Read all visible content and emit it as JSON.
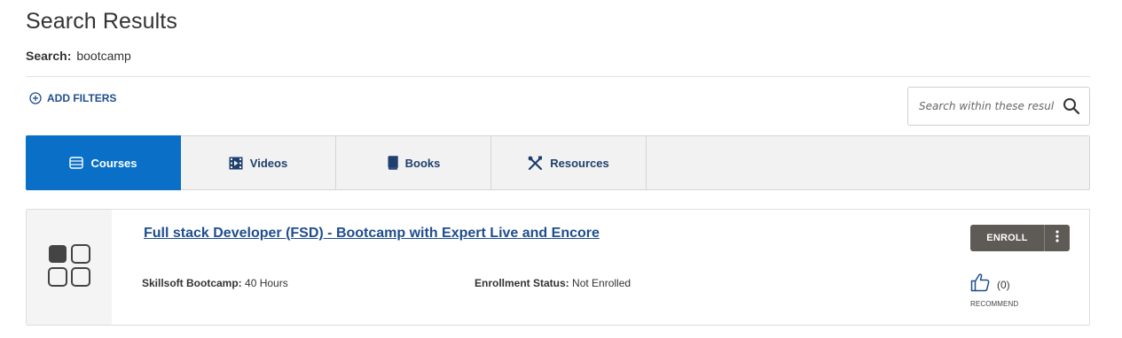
{
  "page": {
    "title": "Search Results",
    "search_label": "Search:",
    "search_term": "bootcamp"
  },
  "filters": {
    "add_label": "ADD FILTERS"
  },
  "within_search": {
    "placeholder": "Search within these results",
    "icon": "search-icon"
  },
  "tabs": [
    {
      "label": "Courses",
      "icon": "courses-icon",
      "active": true
    },
    {
      "label": "Videos",
      "icon": "video-icon",
      "active": false
    },
    {
      "label": "Books",
      "icon": "book-icon",
      "active": false
    },
    {
      "label": "Resources",
      "icon": "tools-icon",
      "active": false
    }
  ],
  "results": [
    {
      "title": "Full stack Developer (FSD) - Bootcamp with Expert Live and Encore",
      "duration_label": "Skillsoft Bootcamp:",
      "duration_value": "40 Hours",
      "status_label": "Enrollment Status:",
      "status_value": "Not Enrolled",
      "enroll_label": "ENROLL",
      "recommend_count": "(0)",
      "recommend_label": "RECOMMEND"
    }
  ],
  "colors": {
    "accent": "#0a70c7",
    "link": "#1f4e8c",
    "button": "#5e5a55"
  }
}
